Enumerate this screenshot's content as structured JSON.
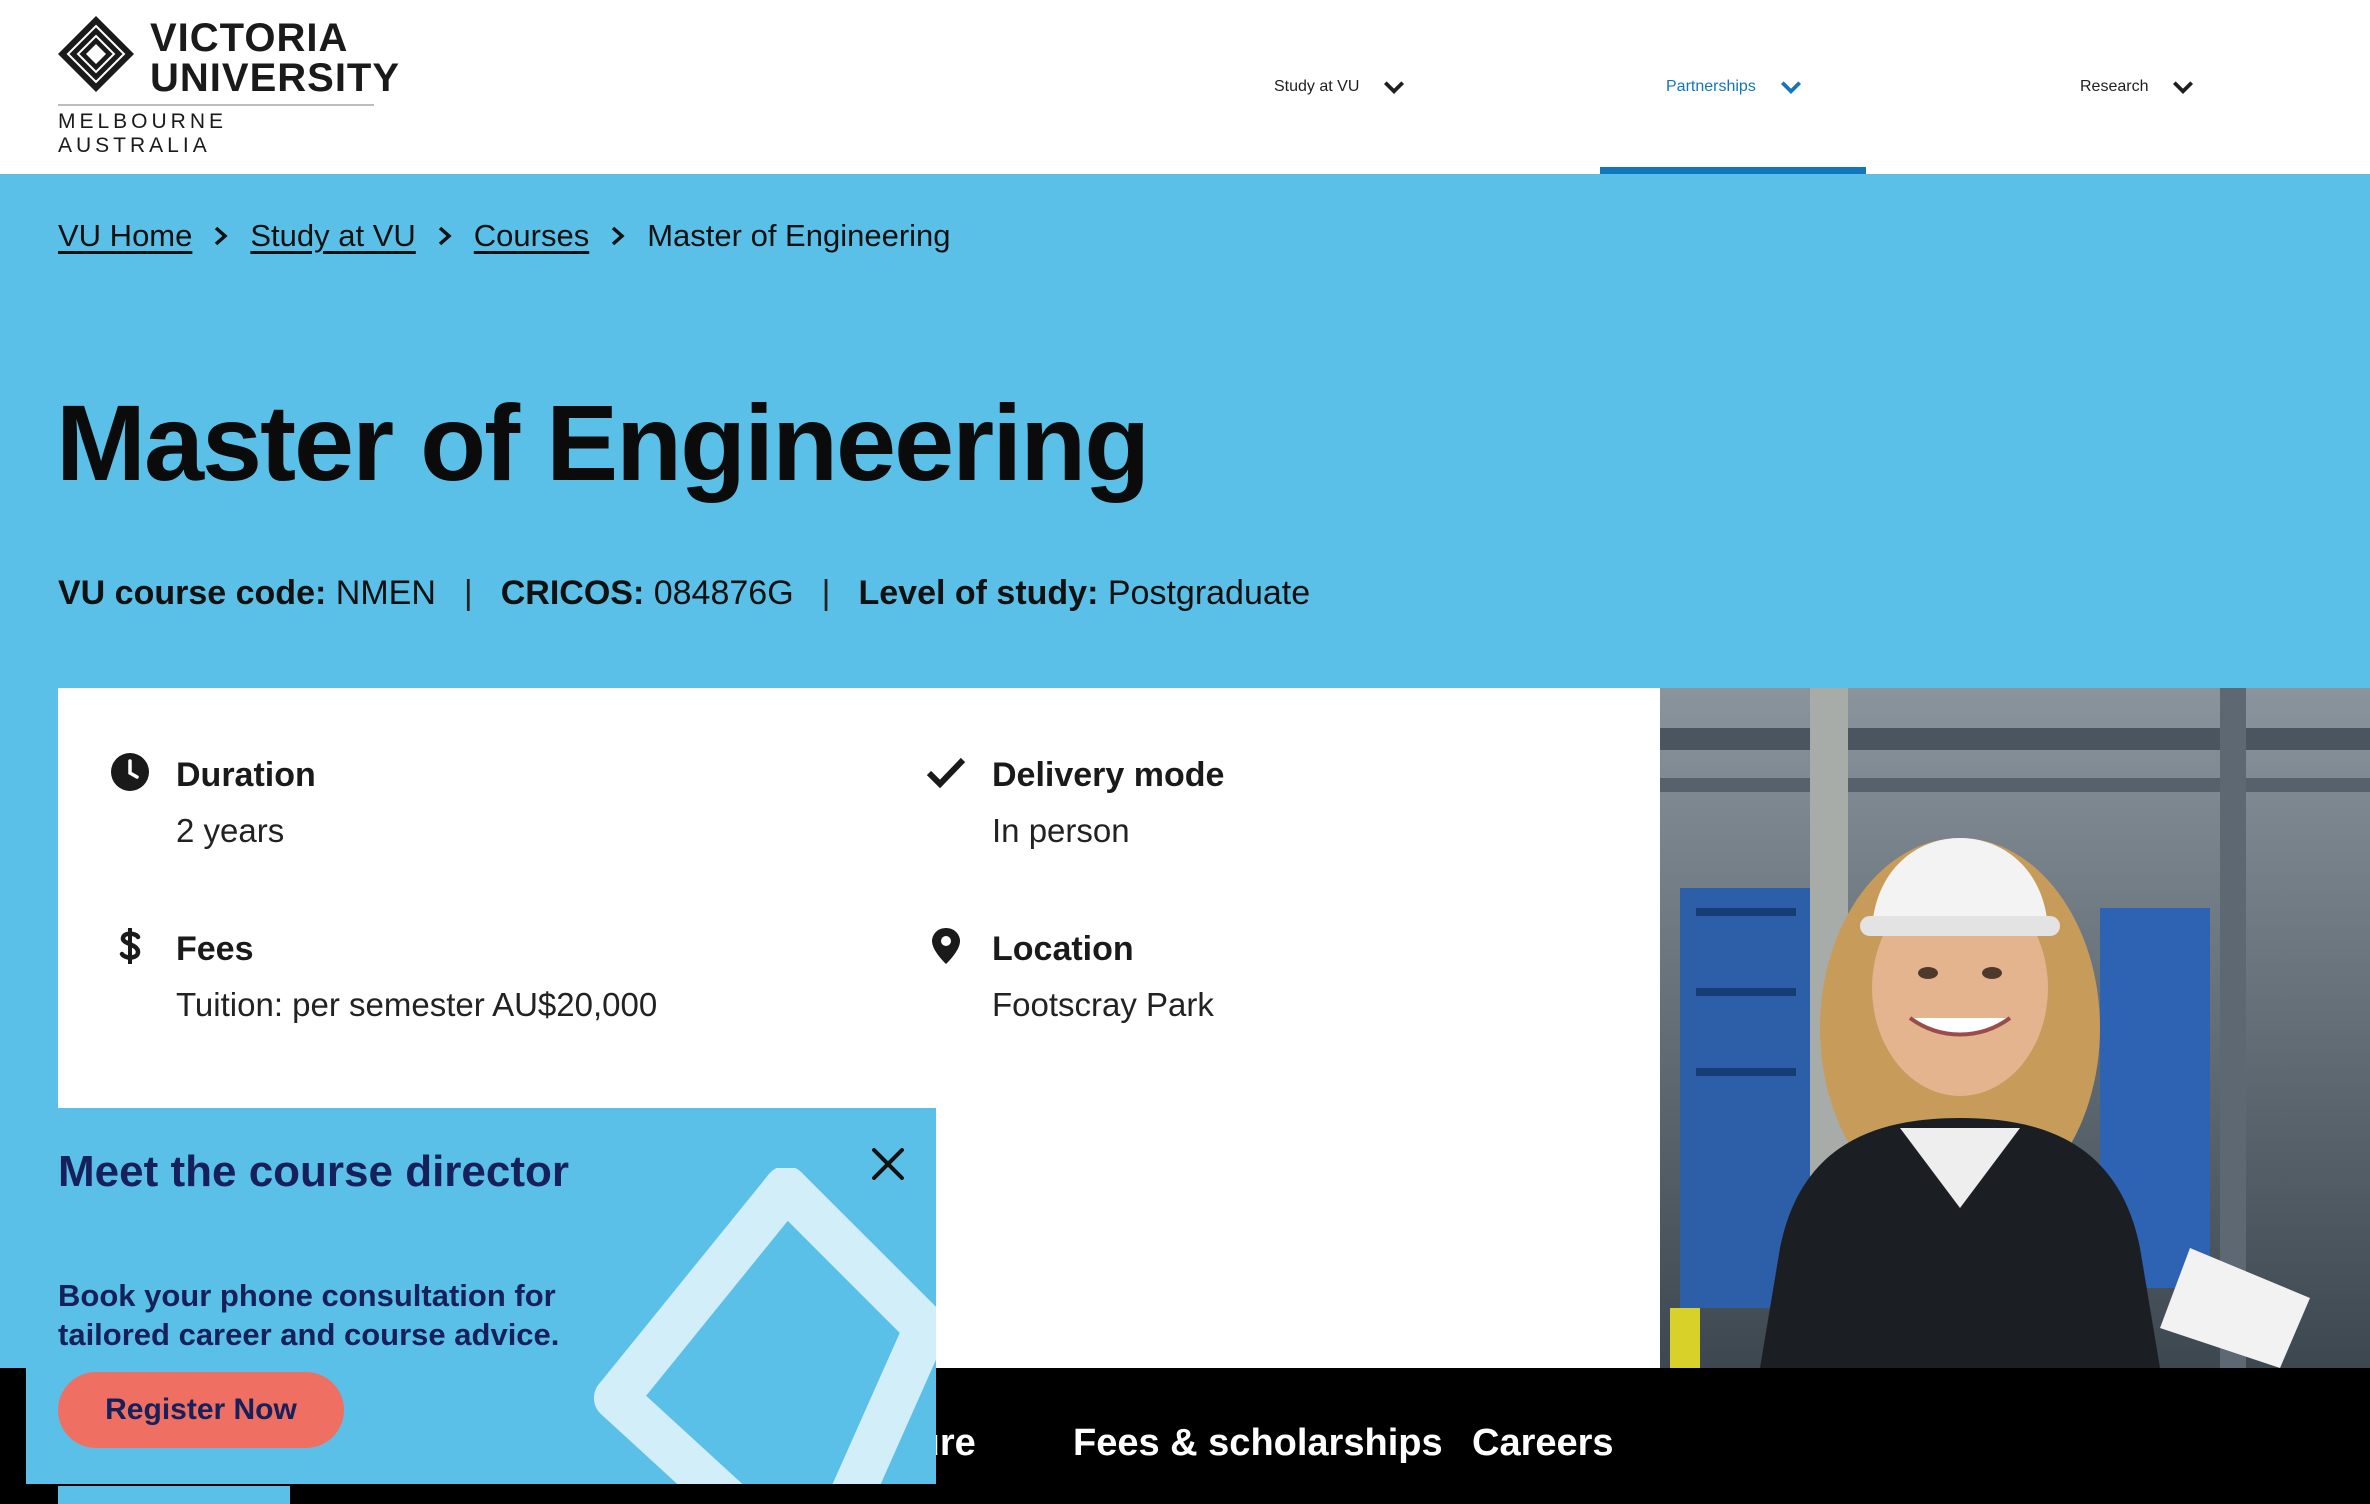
{
  "header": {
    "logo": {
      "name_line1": "VICTORIA",
      "name_line2": "UNIVERSITY",
      "subtitle": "MELBOURNE AUSTRALIA"
    },
    "nav": [
      {
        "label": "Study at VU",
        "icon": "chevron-down-icon",
        "active": false
      },
      {
        "label": "Partnerships",
        "icon": "chevron-down-icon",
        "active": true
      },
      {
        "label": "Research",
        "icon": "chevron-down-icon",
        "active": false
      }
    ]
  },
  "breadcrumb": [
    {
      "label": "VU Home",
      "link": true
    },
    {
      "label": "Study at VU",
      "link": true
    },
    {
      "label": "Courses",
      "link": true
    },
    {
      "label": "Master of Engineering",
      "link": false
    }
  ],
  "page": {
    "title": "Master of Engineering",
    "meta": {
      "course_code_label": "VU course code:",
      "course_code": "NMEN",
      "cricos_label": "CRICOS:",
      "cricos": "084876G",
      "level_label": "Level of study:",
      "level": "Postgraduate",
      "separator": "|"
    }
  },
  "facts": [
    {
      "icon": "clock-icon",
      "label": "Duration",
      "value": "2 years"
    },
    {
      "icon": "check-icon",
      "label": "Delivery mode",
      "value": "In person"
    },
    {
      "icon": "dollar-icon",
      "label": "Fees",
      "value": "Tuition: per semester AU$20,000"
    },
    {
      "icon": "location-pin-icon",
      "label": "Location",
      "value": "Footscray Park"
    }
  ],
  "tabs": [
    {
      "label": "ture"
    },
    {
      "label": "Fees & scholarships"
    },
    {
      "label": "Careers"
    }
  ],
  "popup": {
    "title": "Meet the course director",
    "body": "Book your phone consultation for tailored career and course advice.",
    "button": "Register Now",
    "close_icon": "close-icon"
  },
  "colors": {
    "brand_blue": "#5bc0e8",
    "nav_active": "#1277ba",
    "popup_text": "#16205a",
    "cta": "#ef6f62"
  }
}
